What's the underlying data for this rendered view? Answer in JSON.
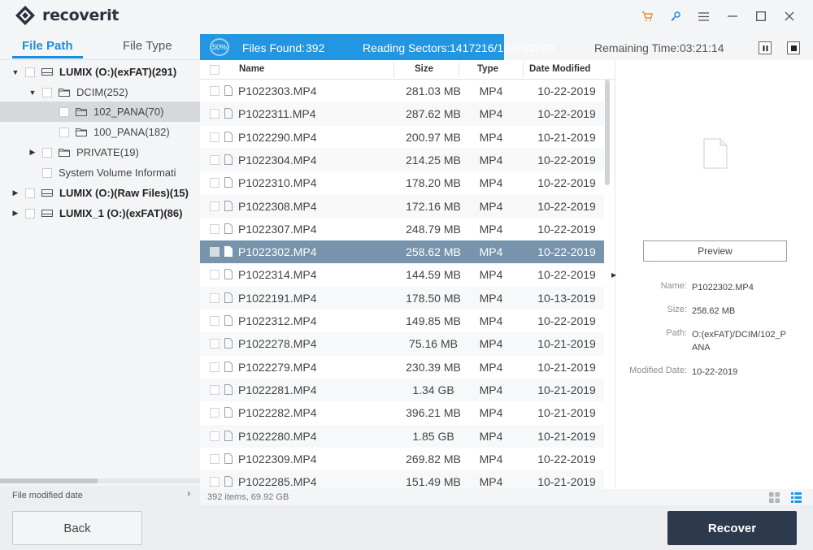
{
  "app": {
    "name": "recoverit"
  },
  "left_tabs": [
    {
      "label": "File Path",
      "active": true
    },
    {
      "label": "File Type",
      "active": false
    }
  ],
  "tree": [
    {
      "label": "LUMIX (O:)(exFAT)(291)",
      "expanded": true,
      "bold": true,
      "icon": "drive-icon"
    },
    {
      "label": "DCIM(252)",
      "expanded": true,
      "bold": false,
      "icon": "folder-icon"
    },
    {
      "label": "102_PANA(70)",
      "selected": true,
      "bold": false,
      "icon": "folder-icon"
    },
    {
      "label": "100_PANA(182)",
      "bold": false,
      "icon": "folder-icon"
    },
    {
      "label": "PRIVATE(19)",
      "expanded": false,
      "bold": false,
      "icon": "folder-icon"
    },
    {
      "label": "System Volume Informati",
      "bold": false,
      "icon": "folder-icon"
    },
    {
      "label": "LUMIX (O:)(Raw Files)(15)",
      "expanded": false,
      "bold": true,
      "icon": "drive-icon"
    },
    {
      "label": "LUMIX_1 (O:)(exFAT)(86)",
      "expanded": false,
      "bold": true,
      "icon": "drive-icon"
    }
  ],
  "filter": {
    "label": "File modified date"
  },
  "progress": {
    "percent_label": "50%",
    "percent": 50,
    "files_found_label": "Files Found:",
    "files_found": "392",
    "reading_label": "Reading Sectors:",
    "reading_value": "1417216/124702720",
    "remaining_label": "Remaining Time:",
    "remaining_value": "03:21:14"
  },
  "table": {
    "headers": {
      "name": "Name",
      "size": "Size",
      "type": "Type",
      "date": "Date Modified"
    },
    "rows": [
      {
        "name": "P1022303.MP4",
        "size": "281.03  MB",
        "type": "MP4",
        "date": "10-22-2019"
      },
      {
        "name": "P1022311.MP4",
        "size": "287.62  MB",
        "type": "MP4",
        "date": "10-22-2019"
      },
      {
        "name": "P1022290.MP4",
        "size": "200.97  MB",
        "type": "MP4",
        "date": "10-21-2019"
      },
      {
        "name": "P1022304.MP4",
        "size": "214.25  MB",
        "type": "MP4",
        "date": "10-22-2019"
      },
      {
        "name": "P1022310.MP4",
        "size": "178.20  MB",
        "type": "MP4",
        "date": "10-22-2019"
      },
      {
        "name": "P1022308.MP4",
        "size": "172.16  MB",
        "type": "MP4",
        "date": "10-22-2019"
      },
      {
        "name": "P1022307.MP4",
        "size": "248.79  MB",
        "type": "MP4",
        "date": "10-22-2019"
      },
      {
        "name": "P1022302.MP4",
        "size": "258.62  MB",
        "type": "MP4",
        "date": "10-22-2019",
        "selected": true
      },
      {
        "name": "P1022314.MP4",
        "size": "144.59  MB",
        "type": "MP4",
        "date": "10-22-2019"
      },
      {
        "name": "P1022191.MP4",
        "size": "178.50  MB",
        "type": "MP4",
        "date": "10-13-2019"
      },
      {
        "name": "P1022312.MP4",
        "size": "149.85  MB",
        "type": "MP4",
        "date": "10-22-2019"
      },
      {
        "name": "P1022278.MP4",
        "size": "75.16  MB",
        "type": "MP4",
        "date": "10-21-2019"
      },
      {
        "name": "P1022279.MP4",
        "size": "230.39  MB",
        "type": "MP4",
        "date": "10-21-2019"
      },
      {
        "name": "P1022281.MP4",
        "size": "1.34  GB",
        "type": "MP4",
        "date": "10-21-2019"
      },
      {
        "name": "P1022282.MP4",
        "size": "396.21  MB",
        "type": "MP4",
        "date": "10-21-2019"
      },
      {
        "name": "P1022280.MP4",
        "size": "1.85  GB",
        "type": "MP4",
        "date": "10-21-2019"
      },
      {
        "name": "P1022309.MP4",
        "size": "269.82  MB",
        "type": "MP4",
        "date": "10-22-2019"
      },
      {
        "name": "P1022285.MP4",
        "size": "151.49  MB",
        "type": "MP4",
        "date": "10-21-2019"
      }
    ]
  },
  "status": {
    "count": "392 items, 69.92  GB"
  },
  "preview": {
    "button": "Preview",
    "name_label": "Name:",
    "name_value": "P1022302.MP4",
    "size_label": "Size:",
    "size_value": "258.62  MB",
    "path_label": "Path:",
    "path_value": "O:(exFAT)/DCIM/102_P ANA",
    "modified_label": "Modified Date:",
    "modified_value": "10-22-2019"
  },
  "footer": {
    "back": "Back",
    "recover": "Recover"
  },
  "colors": {
    "accent": "#2296e0",
    "selected_row": "#7894ac",
    "recover_btn": "#2d3a4d"
  }
}
